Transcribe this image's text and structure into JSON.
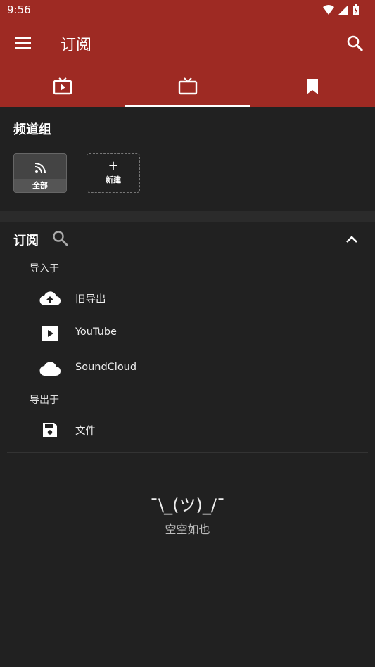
{
  "status_bar": {
    "time": "9:56"
  },
  "toolbar": {
    "title": "订阅"
  },
  "tabs": [
    {
      "icon": "play-tv-icon",
      "active": false
    },
    {
      "icon": "tv-icon",
      "active": true
    },
    {
      "icon": "bookmark-icon",
      "active": false
    }
  ],
  "channel_groups": {
    "title": "频道组",
    "all_label": "全部",
    "new_plus": "+",
    "new_label": "新建"
  },
  "subscriptions": {
    "title": "订阅",
    "import_label": "导入于",
    "import_items": [
      {
        "label": "旧导出",
        "icon": "cloud-upload-icon"
      },
      {
        "label": "YouTube",
        "icon": "youtube-play-icon"
      },
      {
        "label": "SoundCloud",
        "icon": "cloud-icon"
      }
    ],
    "export_label": "导出于",
    "export_items": [
      {
        "label": "文件",
        "icon": "save-icon"
      }
    ]
  },
  "empty_state": {
    "face": "¯\\_(ツ)_/¯",
    "text": "空空如也"
  },
  "colors": {
    "app_bar": "#9e2a23",
    "background": "#212121"
  }
}
